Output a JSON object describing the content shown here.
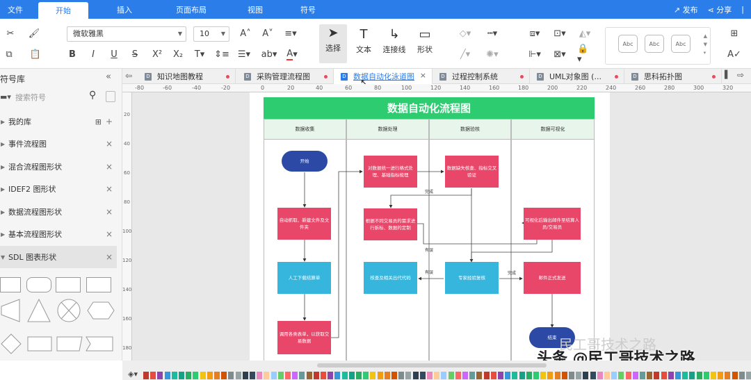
{
  "menu": {
    "items": [
      "文件",
      "开始",
      "插入",
      "页面布局",
      "视图",
      "符号"
    ],
    "active": "开始",
    "publish": "发布",
    "share": "分享"
  },
  "toolbar": {
    "font": "微软雅黑",
    "size": "10",
    "select": "选择",
    "text": "文本",
    "connector": "连接线",
    "shape": "形状",
    "style_samples": [
      "Abc",
      "Abc",
      "Abc"
    ]
  },
  "sidebar": {
    "title": "符号库",
    "search_placeholder": "搜索符号",
    "libraries": [
      {
        "label": "我的库"
      },
      {
        "label": "事件流程图"
      },
      {
        "label": "混合流程图形状"
      },
      {
        "label": "IDEF2 图形状"
      },
      {
        "label": "数据流程图形状"
      },
      {
        "label": "基本流程图形状"
      },
      {
        "label": "SDL 图表形状"
      }
    ]
  },
  "tabs": [
    {
      "label": "知识地图教程"
    },
    {
      "label": "采购管理流程图"
    },
    {
      "label": "数据自动化泳道图"
    },
    {
      "label": "过程控制系统"
    },
    {
      "label": "UML对象图 (..."
    },
    {
      "label": "思科拓扑图"
    }
  ],
  "ruler": {
    "h": [
      "-80",
      "-60",
      "-40",
      "-20",
      "0",
      "20",
      "40",
      "60",
      "80",
      "100",
      "120",
      "140",
      "160",
      "180",
      "200",
      "220",
      "240",
      "260",
      "280",
      "300",
      "320"
    ],
    "v": [
      "20",
      "40",
      "60",
      "80",
      "100",
      "120",
      "140",
      "160",
      "180"
    ]
  },
  "diagram": {
    "title": "数据自动化流程图",
    "lanes": [
      "数据收集",
      "数据处理",
      "数据验核",
      "数据可视化"
    ],
    "nodes": {
      "start": "开始",
      "collect": "自动抓取、新建文件及文件夹",
      "manual": "人工下载结算单",
      "clean": "调用各类表单，以获取交易数据",
      "format": "对数据统一进行格式处理、基础指标梳理",
      "spec": "根据不同交易员的需求进行拆标、数据的定制",
      "handover": "核查及相关出代代码",
      "check": "数据缺失核查、指标交叉验证",
      "expert": "专家经验复核",
      "visual": "可视化后输出邮件至结算人员/交易员",
      "mail": "邮件正式发送",
      "end": "结束"
    },
    "edge_labels": {
      "done1": "完成",
      "fail1": "有误",
      "fail2": "有误",
      "done2": "完成"
    }
  },
  "watermark": {
    "line1": "民工哥技术之路",
    "line2": "头条 @民工哥技术之路"
  },
  "palette": [
    "#c0392b",
    "#e74c3c",
    "#8e44ad",
    "#3498db",
    "#1abc9c",
    "#16a085",
    "#27ae60",
    "#2ecc71",
    "#f1c40f",
    "#f39c12",
    "#e67e22",
    "#d35400",
    "#7f8c8d",
    "#95a5a6",
    "#2c3e50",
    "#34495e",
    "#ec87c0",
    "#ffcc99",
    "#99ccff",
    "#66cc66",
    "#ff6666",
    "#cc66ff",
    "#669999",
    "#996633"
  ]
}
